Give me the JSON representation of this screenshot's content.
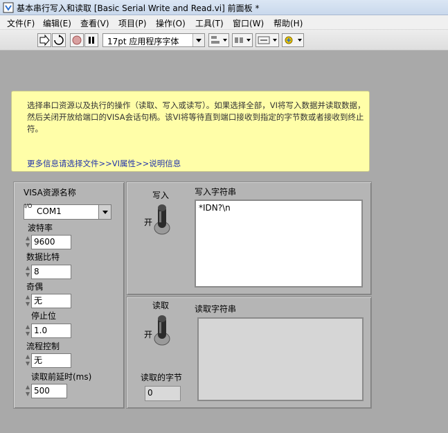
{
  "window": {
    "title": "基本串行写入和读取 [Basic Serial Write and Read.vi] 前面板 *"
  },
  "menu": [
    "文件(F)",
    "编辑(E)",
    "查看(V)",
    "项目(P)",
    "操作(O)",
    "工具(T)",
    "窗口(W)",
    "帮助(H)"
  ],
  "toolbar": {
    "font": "17pt 应用程序字体"
  },
  "note": {
    "text": "选择串口资源以及执行的操作（读取、写入或读写）。如果选择全部，VI将写入数据并读取数据，然后关闭开放给端口的VISA会话句柄。该VI将等待直到端口接收到指定的字节数或者接收到终止符。",
    "link": "更多信息请选择文件>>VI属性>>说明信息"
  },
  "config": {
    "visa_label": "VISA资源名称",
    "visa_value": "COM1",
    "visa_prefix": "I/O",
    "baud_label": "波特率",
    "baud_value": "9600",
    "databits_label": "数据比特",
    "databits_value": "8",
    "parity_label": "奇偶",
    "parity_value": "无",
    "stopbits_label": "停止位",
    "stopbits_value": "1.0",
    "flow_label": "流程控制",
    "flow_value": "无",
    "delay_label": "读取前延时(ms)",
    "delay_value": "500"
  },
  "write": {
    "toggle_label": "写入",
    "toggle_state": "开",
    "string_label": "写入字符串",
    "string_value": "*IDN?\\n"
  },
  "read": {
    "toggle_label": "读取",
    "toggle_state": "开",
    "string_label": "读取字符串",
    "string_value": "",
    "bytes_label": "读取的字节",
    "bytes_value": "0"
  }
}
